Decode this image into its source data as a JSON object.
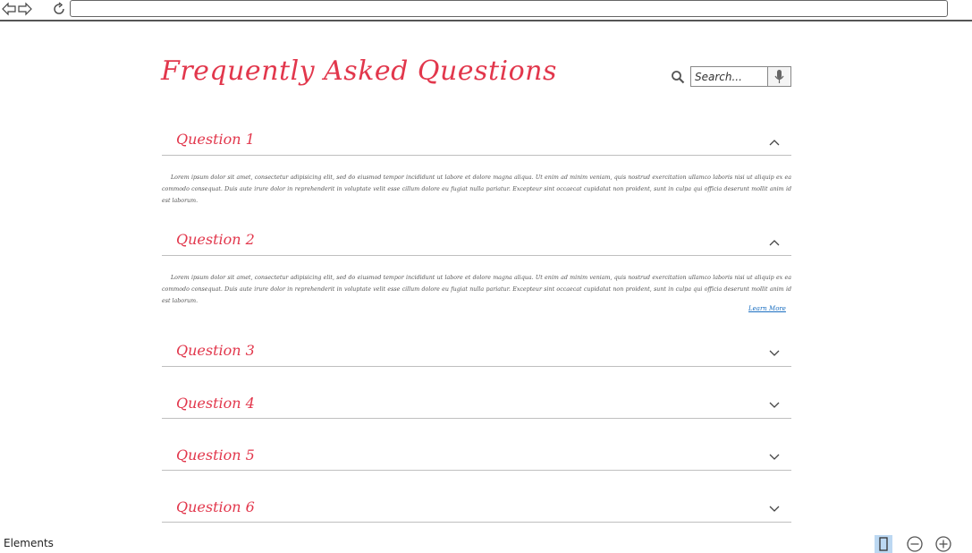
{
  "browser": {
    "back_icon": "back-arrow-icon",
    "forward_icon": "forward-arrow-icon",
    "reload_icon": "reload-icon",
    "url": ""
  },
  "page": {
    "title": "Frequently Asked Questions",
    "search": {
      "placeholder": "Search...",
      "value": ""
    },
    "lorem": "Lorem ipsum dolor sit amet, consectetur adipisicing elit, sed do eiusmod tempor incididunt ut labore et dolore magna aliqua. Ut enim ad minim veniam, quis nostrud exercitation ullamco laboris nisi ut aliquip ex ea commodo consequat. Duis aute irure dolor in reprehenderit in voluptate velit esse cillum dolore eu fugiat nulla pariatur. Excepteur sint occaecat cupidatat non proident, sunt in culpa qui officia deserunt mollit anim id est laborum.",
    "learn_more": "Learn More",
    "questions": [
      {
        "label": "Question 1",
        "expanded": true
      },
      {
        "label": "Question 2",
        "expanded": true
      },
      {
        "label": "Question 3",
        "expanded": false
      },
      {
        "label": "Question 4",
        "expanded": false
      },
      {
        "label": "Question 5",
        "expanded": false
      },
      {
        "label": "Question 6",
        "expanded": false
      }
    ]
  },
  "footer": {
    "label": "Elements",
    "buttons": [
      "page-view-icon",
      "zoom-out-icon",
      "zoom-in-icon"
    ]
  },
  "colors": {
    "accent": "#e2374c",
    "link": "#1b6fc1",
    "divider": "#bfbfbf"
  }
}
